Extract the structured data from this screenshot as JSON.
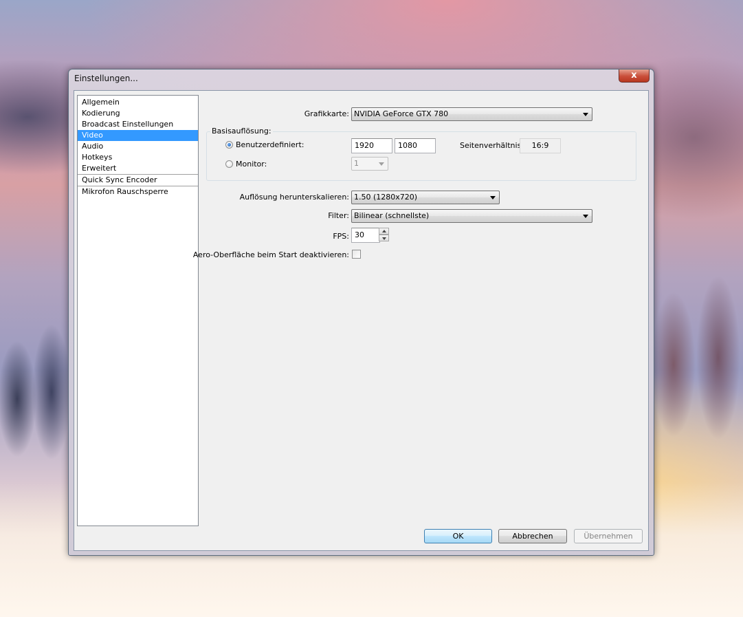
{
  "window": {
    "title": "Einstellungen...",
    "close_glyph": "x"
  },
  "sidebar": {
    "items": [
      {
        "label": "Allgemein"
      },
      {
        "label": "Kodierung"
      },
      {
        "label": "Broadcast Einstellungen"
      },
      {
        "label": "Video",
        "selected": true
      },
      {
        "label": "Audio"
      },
      {
        "label": "Hotkeys"
      },
      {
        "label": "Erweitert"
      },
      {
        "label": "Quick Sync Encoder"
      },
      {
        "label": "Mikrofon Rauschsperre"
      }
    ]
  },
  "video": {
    "gpu_label": "Grafikkarte:",
    "gpu_value": "NVIDIA GeForce GTX 780",
    "base_group_title": "Basisauflösung:",
    "custom_label": "Benutzerdefiniert:",
    "custom_width": "1920",
    "custom_height": "1080",
    "aspect_label": "Seitenverhältnis:",
    "aspect_value": "16:9",
    "monitor_label": "Monitor:",
    "monitor_value": "1",
    "downscale_label": "Auflösung herunterskalieren:",
    "downscale_value": "1.50  (1280x720)",
    "filter_label": "Filter:",
    "filter_value": "Bilinear (schnellste)",
    "fps_label": "FPS:",
    "fps_value": "30",
    "aero_label": "Aero-Oberfläche beim Start deaktivieren:"
  },
  "buttons": {
    "ok": "OK",
    "cancel": "Abbrechen",
    "apply": "Übernehmen"
  },
  "colors": {
    "selection": "#3399ff",
    "close_button": "#c94f3a"
  }
}
